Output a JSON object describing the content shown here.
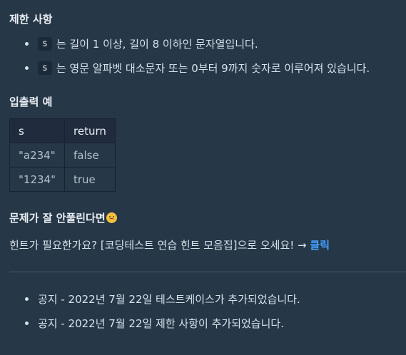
{
  "constraints": {
    "heading": "제한 사항",
    "items": [
      {
        "code": "s",
        "text": "는 길이 1 이상, 길이 8 이하인 문자열입니다."
      },
      {
        "code": "s",
        "text": "는 영문 알파벳 대소문자 또는 0부터 9까지 숫자로 이루어져 있습니다."
      }
    ]
  },
  "io_example": {
    "heading": "입출력 예",
    "columns": [
      "s",
      "return"
    ],
    "rows": [
      [
        "\"a234\"",
        "false"
      ],
      [
        "\"1234\"",
        "true"
      ]
    ]
  },
  "hint": {
    "heading": "문제가 잘 안풀린다면",
    "emoji_icon": "sad-face-icon",
    "text": "힌트가 필요한가요? [코딩테스트 연습 힌트 모음집]으로 오세요! →",
    "link_label": "클릭",
    "link_color": "#44a0ff"
  },
  "notices": [
    "공지 - 2022년 7월 22일 테스트케이스가 추가되었습니다.",
    "공지 - 2022년 7월 22일 제한 사항이 추가되었습니다."
  ],
  "colors": {
    "background": "#263747",
    "table_header_bg": "#202b3d",
    "code_chip_bg": "#1b2938"
  }
}
